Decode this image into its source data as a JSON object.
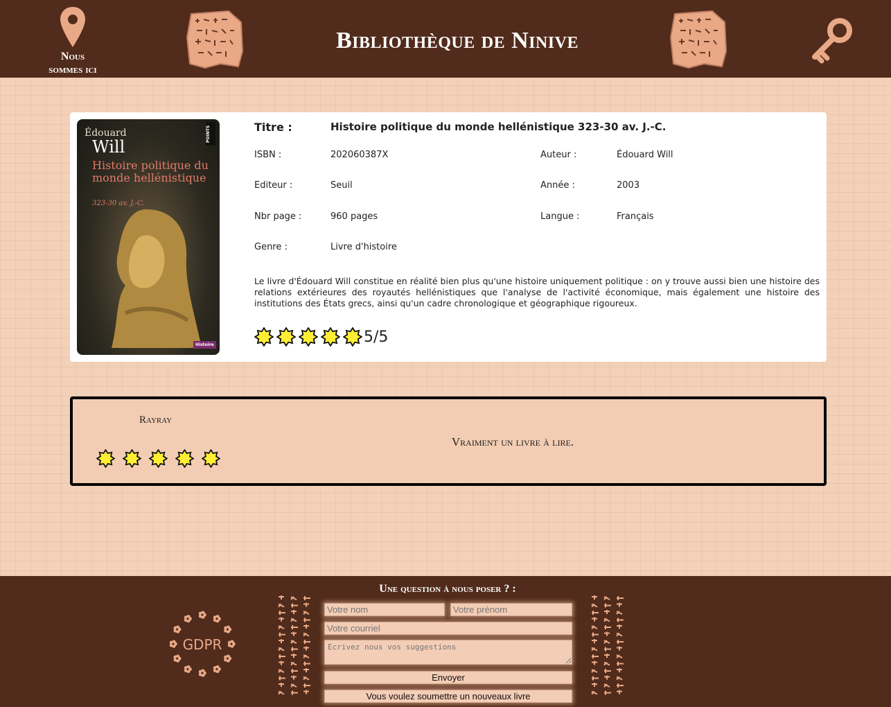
{
  "header": {
    "location_label_line1": "Nous",
    "location_label_line2": "sommes ici",
    "site_title": "Bibliothèque de Ninive"
  },
  "book": {
    "cover": {
      "author_first": "Édouard",
      "author_last": "Will",
      "title": "Histoire politique du monde hellénistique",
      "dates": "323-30 av. J.-C.",
      "publisher_mark": "POINTS",
      "genre_tag": "Histoire"
    },
    "title_label": "Titre :",
    "title": "Histoire politique du monde hellénistique 323-30 av. J.-C.",
    "fields": {
      "isbn_label": "ISBN :",
      "isbn": "202060387X",
      "author_label": "Auteur :",
      "author": "Édouard Will",
      "publisher_label": "Editeur :",
      "publisher": "Seuil",
      "year_label": "Année :",
      "year": "2003",
      "pages_label": "Nbr page :",
      "pages": "960 pages",
      "language_label": "Langue :",
      "language": "Français",
      "genre_label": "Genre :",
      "genre": "Livre d'histoire"
    },
    "description": "Le livre d'Édouard Will constitue en réalité bien plus qu'une histoire uniquement politique : on y trouve aussi bien une histoire des relations extérieures des royautés hellénistiques que l'analyse de l'activité économique, mais également une histoire des institutions des États grecs, ainsi qu'un cadre chronologique et géographique rigoureux.",
    "rating_stars": 5,
    "rating_text": "5/5"
  },
  "review": {
    "reviewer": "Rayray",
    "stars": 5,
    "comment": "Vraiment un livre à lire."
  },
  "footer": {
    "gdpr_label": "GDPR",
    "form_title": "Une question à nous poser ? :",
    "first_name_placeholder": "Votre nom",
    "last_name_placeholder": "Votre prénom",
    "email_placeholder": "Votre courriel",
    "message_placeholder": "Ecrivez nous vos suggestions",
    "send_label": "Envoyer",
    "submit_book_label": "Vous voulez soumettre un nouveaux livre"
  },
  "colors": {
    "header_bg": "#512b1b",
    "page_bg": "#f3d0b8",
    "accent_clay": "#e9a987",
    "star_fill": "#ffee33"
  },
  "icons": {
    "location": "map-pin-icon",
    "tablet": "cuneiform-tablet-icon",
    "key": "key-icon",
    "star": "star-icon",
    "gdpr": "gdpr-badge-icon"
  }
}
